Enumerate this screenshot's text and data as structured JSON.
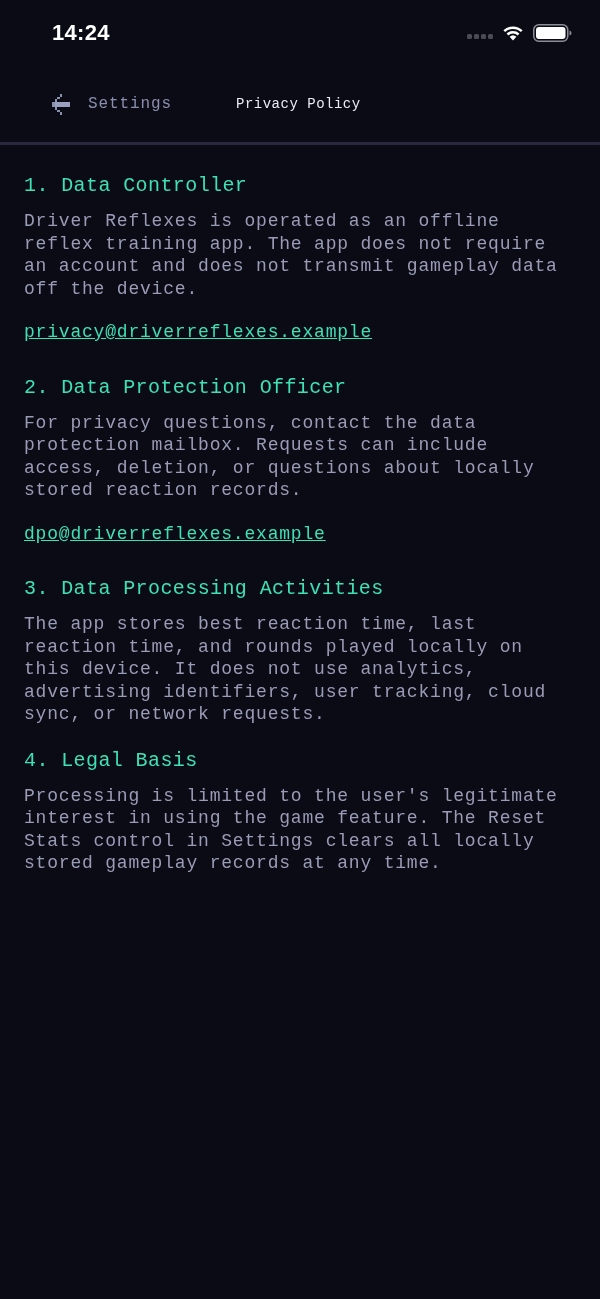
{
  "status_bar": {
    "time": "14:24"
  },
  "nav": {
    "back_label": "Settings",
    "title": "Privacy Policy"
  },
  "sections": [
    {
      "heading": "1. Data Controller",
      "body": "Driver Reflexes is operated as an offline reflex training app. The app does not require an account and does not transmit gameplay data off the device.",
      "link": "privacy@driverreflexes.example"
    },
    {
      "heading": "2. Data Protection Officer",
      "body": "For privacy questions, contact the data protection mailbox. Requests can include access, deletion, or questions about locally stored reaction records.",
      "link": "dpo@driverreflexes.example"
    },
    {
      "heading": "3. Data Processing Activities",
      "body": "The app stores best reaction time, last reaction time, and rounds played locally on this device. It does not use analytics, advertising identifiers, user tracking, cloud sync, or network requests."
    },
    {
      "heading": "4. Legal Basis",
      "body": "Processing is limited to the user's legitimate interest in using the game feature. The Reset Stats control in Settings clears all locally stored gameplay records at any time."
    }
  ]
}
